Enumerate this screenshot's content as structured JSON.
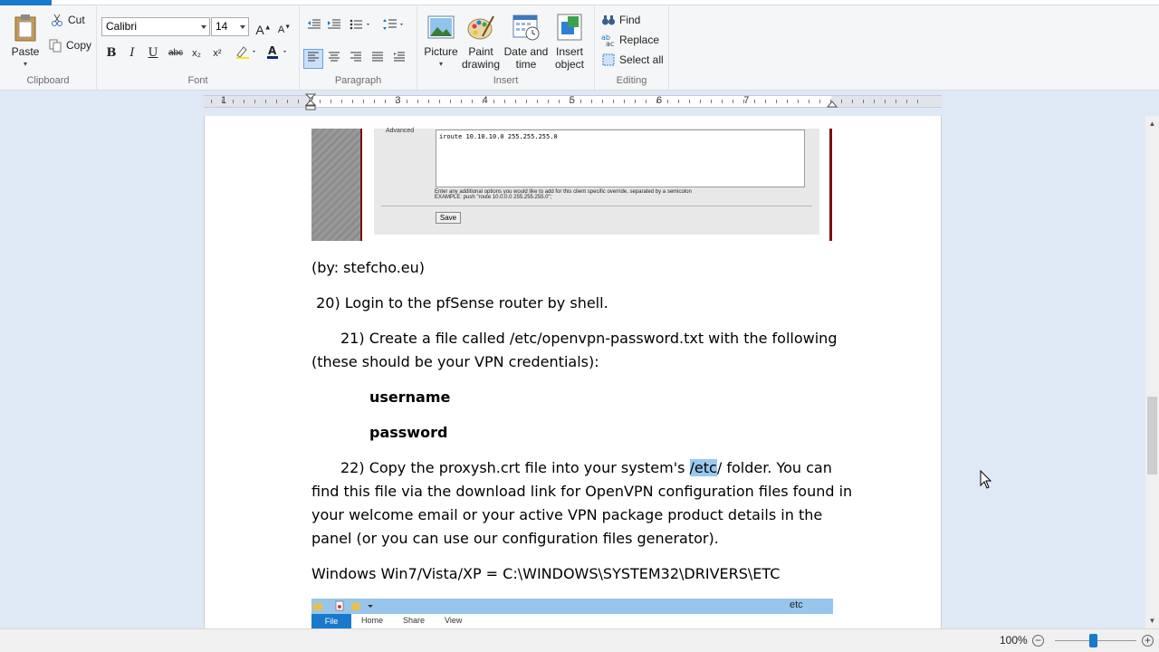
{
  "ribbon": {
    "clipboard": {
      "label": "Clipboard",
      "paste": "Paste",
      "cut": "Cut",
      "copy": "Copy"
    },
    "font": {
      "label": "Font",
      "family": "Calibri",
      "size": "14",
      "bold": "B",
      "italic": "I",
      "underline": "U",
      "strike": "abc",
      "subscript": "x₂",
      "superscript": "x²"
    },
    "paragraph": {
      "label": "Paragraph"
    },
    "insert": {
      "label": "Insert",
      "picture": "Picture",
      "paint_1": "Paint",
      "paint_2": "drawing",
      "datetime_1": "Date and",
      "datetime_2": "time",
      "object_1": "Insert",
      "object_2": "object"
    },
    "editing": {
      "label": "Editing",
      "find": "Find",
      "replace": "Replace",
      "select_all": "Select all"
    }
  },
  "ruler": {
    "numbers": [
      "1",
      "2",
      "3",
      "4",
      "5",
      "6",
      "7"
    ]
  },
  "document": {
    "shot1": {
      "advanced": "Advanced",
      "textarea": "iroute 10.10.10.0 255.255.255.0",
      "hint1": "Enter any additional options you would like to add for this client specific override, separated by a semicolon",
      "hint2": "EXAMPLE: push \"route 10.0.0.0 255.255.255.0\";",
      "save": "Save"
    },
    "credit": "(by: stefcho.eu)",
    "step20": " 20) Login to the pfSense router by shell.",
    "step21_line1": "21) Create a file called /etc/openvpn-password.txt with the following",
    "step21_line2": "(these should be your VPN credentials):",
    "username": "username",
    "password": "password",
    "step22_pre": "22) Copy the proxysh.crt file into your system's ",
    "step22_sel": "/etc",
    "step22_post": "/ folder. You can",
    "step22_line2": "find this file via the download link for OpenVPN configuration files found in",
    "step22_line3": "your welcome email or your active VPN package product details in the",
    "step22_line4": "panel (or you can use our configuration files generator).",
    "windows_path": "Windows Win7/Vista/XP = C:\\WINDOWS\\SYSTEM32\\DRIVERS\\ETC",
    "shot2": {
      "title": "etc",
      "file": "File",
      "home": "Home",
      "share": "Share",
      "view": "View"
    }
  },
  "status": {
    "zoom": "100%"
  }
}
